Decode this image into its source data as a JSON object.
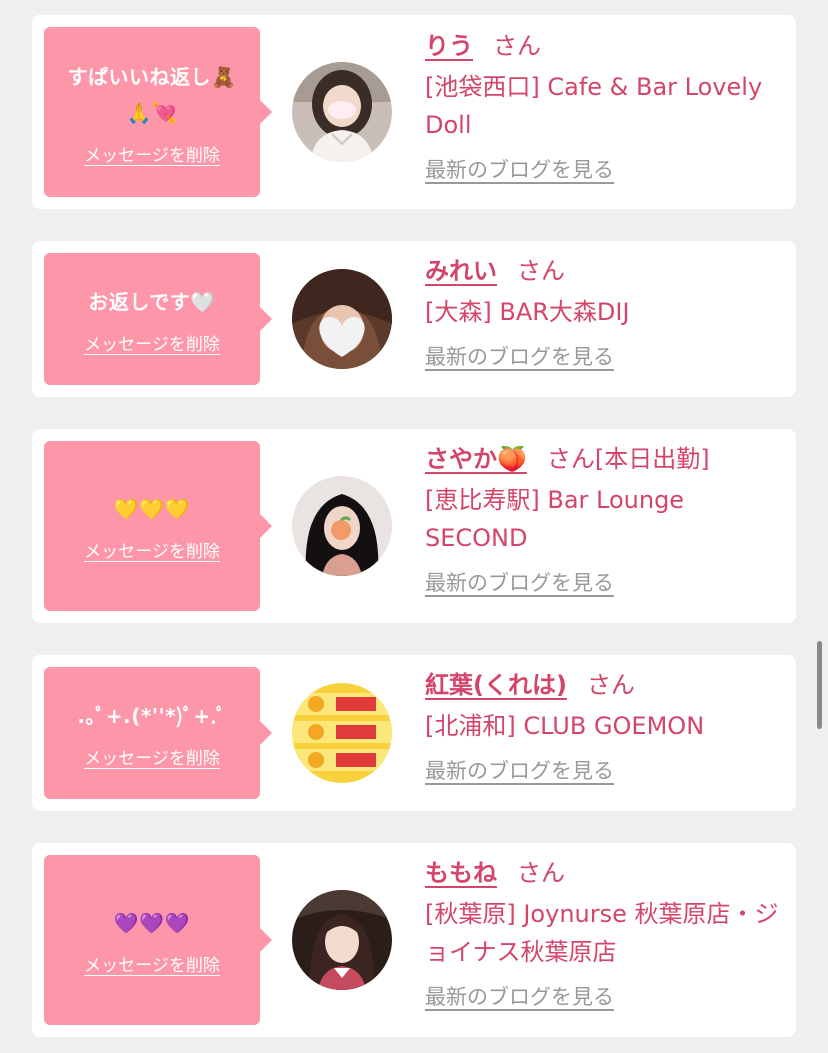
{
  "common": {
    "san_label": "さん",
    "delete_label": "メッセージを削除",
    "blog_label": "最新のブログを見る"
  },
  "items": [
    {
      "message": "すぱいいね返し🧸\n🙏💘",
      "name": "りう",
      "suffix": "",
      "shop": "[池袋西口] Cafe & Bar Lovely Doll",
      "avatar": "avatar-girl-white-blouse"
    },
    {
      "message": "お返しです🤍",
      "name": "みれい",
      "suffix": "",
      "shop": "[大森] BAR大森DIJ",
      "avatar": "avatar-girl-heart-face"
    },
    {
      "message": "💛💛💛",
      "name": "さやか🍑",
      "suffix": "[本日出勤]",
      "shop": "[恵比寿駅] Bar Lounge SECOND",
      "avatar": "avatar-girl-peach-face"
    },
    {
      "message": ".｡ﾟ+.(*''*)ﾟ+.ﾟ",
      "name": "紅葉(くれは)",
      "suffix": "",
      "shop": "[北浦和] CLUB GOEMON",
      "avatar": "avatar-wrap-product"
    },
    {
      "message": "💜💜💜",
      "name": "ももね",
      "suffix": "",
      "shop": "[秋葉原] Joynurse 秋葉原店・ジョイナス秋葉原店",
      "avatar": "avatar-girl-maid"
    }
  ]
}
